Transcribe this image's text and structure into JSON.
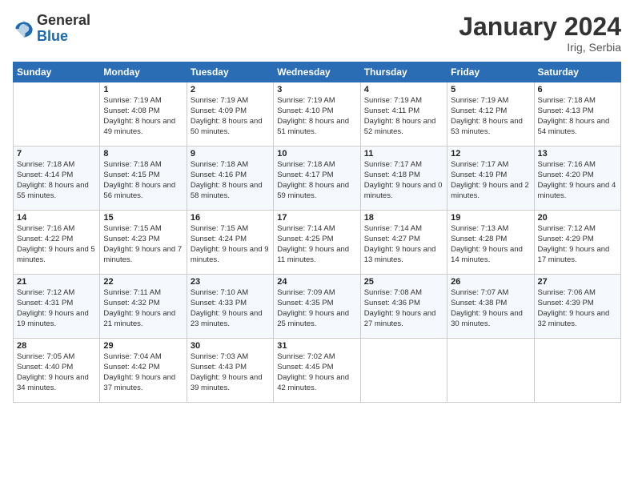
{
  "logo": {
    "general": "General",
    "blue": "Blue"
  },
  "title": "January 2024",
  "subtitle": "Irig, Serbia",
  "days_header": [
    "Sunday",
    "Monday",
    "Tuesday",
    "Wednesday",
    "Thursday",
    "Friday",
    "Saturday"
  ],
  "weeks": [
    [
      {
        "num": "",
        "sunrise": "",
        "sunset": "",
        "daylight": ""
      },
      {
        "num": "1",
        "sunrise": "7:19 AM",
        "sunset": "4:08 PM",
        "daylight": "8 hours and 49 minutes."
      },
      {
        "num": "2",
        "sunrise": "7:19 AM",
        "sunset": "4:09 PM",
        "daylight": "8 hours and 50 minutes."
      },
      {
        "num": "3",
        "sunrise": "7:19 AM",
        "sunset": "4:10 PM",
        "daylight": "8 hours and 51 minutes."
      },
      {
        "num": "4",
        "sunrise": "7:19 AM",
        "sunset": "4:11 PM",
        "daylight": "8 hours and 52 minutes."
      },
      {
        "num": "5",
        "sunrise": "7:19 AM",
        "sunset": "4:12 PM",
        "daylight": "8 hours and 53 minutes."
      },
      {
        "num": "6",
        "sunrise": "7:18 AM",
        "sunset": "4:13 PM",
        "daylight": "8 hours and 54 minutes."
      }
    ],
    [
      {
        "num": "7",
        "sunrise": "7:18 AM",
        "sunset": "4:14 PM",
        "daylight": "8 hours and 55 minutes."
      },
      {
        "num": "8",
        "sunrise": "7:18 AM",
        "sunset": "4:15 PM",
        "daylight": "8 hours and 56 minutes."
      },
      {
        "num": "9",
        "sunrise": "7:18 AM",
        "sunset": "4:16 PM",
        "daylight": "8 hours and 58 minutes."
      },
      {
        "num": "10",
        "sunrise": "7:18 AM",
        "sunset": "4:17 PM",
        "daylight": "8 hours and 59 minutes."
      },
      {
        "num": "11",
        "sunrise": "7:17 AM",
        "sunset": "4:18 PM",
        "daylight": "9 hours and 0 minutes."
      },
      {
        "num": "12",
        "sunrise": "7:17 AM",
        "sunset": "4:19 PM",
        "daylight": "9 hours and 2 minutes."
      },
      {
        "num": "13",
        "sunrise": "7:16 AM",
        "sunset": "4:20 PM",
        "daylight": "9 hours and 4 minutes."
      }
    ],
    [
      {
        "num": "14",
        "sunrise": "7:16 AM",
        "sunset": "4:22 PM",
        "daylight": "9 hours and 5 minutes."
      },
      {
        "num": "15",
        "sunrise": "7:15 AM",
        "sunset": "4:23 PM",
        "daylight": "9 hours and 7 minutes."
      },
      {
        "num": "16",
        "sunrise": "7:15 AM",
        "sunset": "4:24 PM",
        "daylight": "9 hours and 9 minutes."
      },
      {
        "num": "17",
        "sunrise": "7:14 AM",
        "sunset": "4:25 PM",
        "daylight": "9 hours and 11 minutes."
      },
      {
        "num": "18",
        "sunrise": "7:14 AM",
        "sunset": "4:27 PM",
        "daylight": "9 hours and 13 minutes."
      },
      {
        "num": "19",
        "sunrise": "7:13 AM",
        "sunset": "4:28 PM",
        "daylight": "9 hours and 14 minutes."
      },
      {
        "num": "20",
        "sunrise": "7:12 AM",
        "sunset": "4:29 PM",
        "daylight": "9 hours and 17 minutes."
      }
    ],
    [
      {
        "num": "21",
        "sunrise": "7:12 AM",
        "sunset": "4:31 PM",
        "daylight": "9 hours and 19 minutes."
      },
      {
        "num": "22",
        "sunrise": "7:11 AM",
        "sunset": "4:32 PM",
        "daylight": "9 hours and 21 minutes."
      },
      {
        "num": "23",
        "sunrise": "7:10 AM",
        "sunset": "4:33 PM",
        "daylight": "9 hours and 23 minutes."
      },
      {
        "num": "24",
        "sunrise": "7:09 AM",
        "sunset": "4:35 PM",
        "daylight": "9 hours and 25 minutes."
      },
      {
        "num": "25",
        "sunrise": "7:08 AM",
        "sunset": "4:36 PM",
        "daylight": "9 hours and 27 minutes."
      },
      {
        "num": "26",
        "sunrise": "7:07 AM",
        "sunset": "4:38 PM",
        "daylight": "9 hours and 30 minutes."
      },
      {
        "num": "27",
        "sunrise": "7:06 AM",
        "sunset": "4:39 PM",
        "daylight": "9 hours and 32 minutes."
      }
    ],
    [
      {
        "num": "28",
        "sunrise": "7:05 AM",
        "sunset": "4:40 PM",
        "daylight": "9 hours and 34 minutes."
      },
      {
        "num": "29",
        "sunrise": "7:04 AM",
        "sunset": "4:42 PM",
        "daylight": "9 hours and 37 minutes."
      },
      {
        "num": "30",
        "sunrise": "7:03 AM",
        "sunset": "4:43 PM",
        "daylight": "9 hours and 39 minutes."
      },
      {
        "num": "31",
        "sunrise": "7:02 AM",
        "sunset": "4:45 PM",
        "daylight": "9 hours and 42 minutes."
      },
      {
        "num": "",
        "sunrise": "",
        "sunset": "",
        "daylight": ""
      },
      {
        "num": "",
        "sunrise": "",
        "sunset": "",
        "daylight": ""
      },
      {
        "num": "",
        "sunrise": "",
        "sunset": "",
        "daylight": ""
      }
    ]
  ]
}
